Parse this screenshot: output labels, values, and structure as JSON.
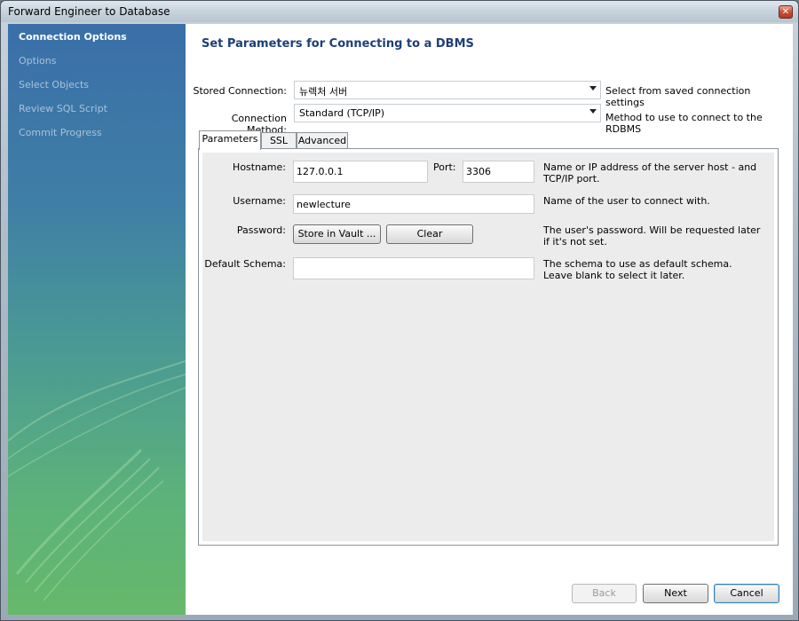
{
  "window": {
    "title": "Forward Engineer to Database",
    "close_glyph": "✕"
  },
  "sidebar": {
    "items": [
      {
        "label": "Connection Options",
        "active": true
      },
      {
        "label": "Options",
        "active": false
      },
      {
        "label": "Select Objects",
        "active": false
      },
      {
        "label": "Review SQL Script",
        "active": false
      },
      {
        "label": "Commit Progress",
        "active": false
      }
    ]
  },
  "main": {
    "heading": "Set Parameters for Connecting to a DBMS",
    "stored_connection": {
      "label": "Stored Connection:",
      "value": "뉴렉처 서버",
      "hint": "Select from saved connection settings"
    },
    "connection_method": {
      "label": "Connection Method:",
      "value": "Standard (TCP/IP)",
      "hint": "Method to use to connect to the RDBMS"
    },
    "tabs": [
      {
        "label": "Parameters",
        "active": true
      },
      {
        "label": "SSL",
        "active": false
      },
      {
        "label": "Advanced",
        "active": false
      }
    ],
    "parameters": {
      "hostname": {
        "label": "Hostname:",
        "value": "127.0.0.1"
      },
      "port": {
        "label": "Port:",
        "value": "3306"
      },
      "host_hint": "Name or IP address of the server host - and TCP/IP port.",
      "username": {
        "label": "Username:",
        "value": "newlecture",
        "hint": "Name of the user to connect with."
      },
      "password": {
        "label": "Password:",
        "store_button": "Store in Vault ...",
        "clear_button": "Clear",
        "hint": "The user's password. Will be requested later if it's not set."
      },
      "default_schema": {
        "label": "Default Schema:",
        "value": "",
        "hint": "The schema to use as default schema. Leave blank to select it later."
      }
    }
  },
  "footer": {
    "back_label": "Back",
    "next_label": "Next",
    "cancel_label": "Cancel"
  },
  "colors": {
    "heading": "#1e3f78",
    "sidebar_top": "#3a6fa8",
    "sidebar_bottom": "#66b86a",
    "default_button_border": "#3c7fb1"
  }
}
